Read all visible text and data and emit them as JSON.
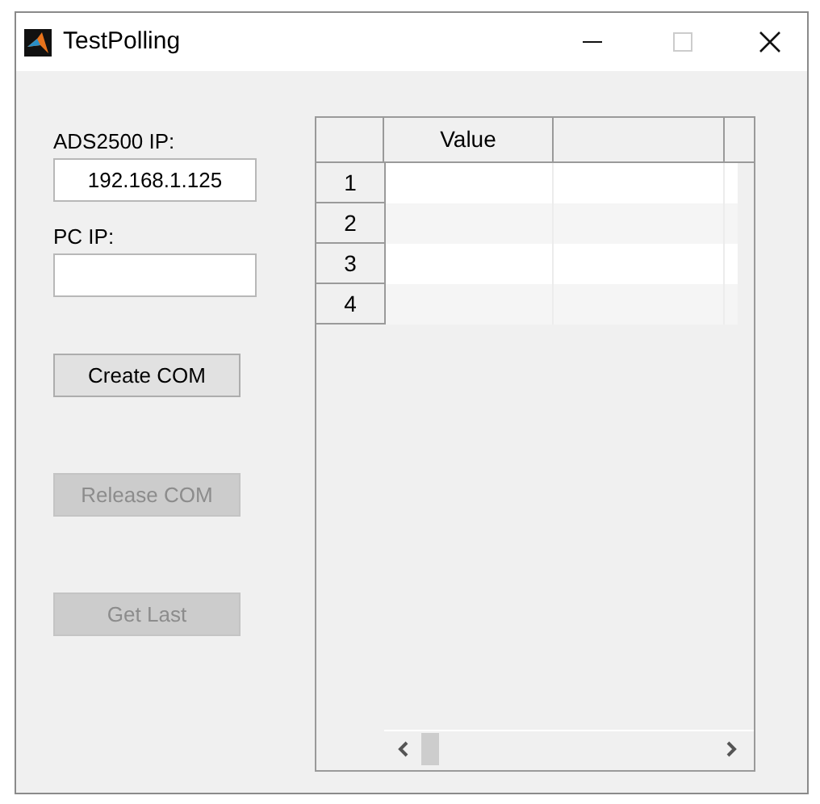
{
  "window": {
    "title": "TestPolling"
  },
  "fields": [
    {
      "label": "ADS2500 IP:",
      "value": "192.168.1.125"
    },
    {
      "label": "PC IP:"
    }
  ],
  "buttons": [
    {
      "label": "Create COM",
      "disabled": false
    },
    {
      "label": "Release COM",
      "disabled": true
    },
    {
      "label": "Get Last",
      "disabled": true
    }
  ],
  "table": {
    "columns": [
      "Value"
    ],
    "rows": [
      "1",
      "2",
      "3",
      "4"
    ]
  }
}
